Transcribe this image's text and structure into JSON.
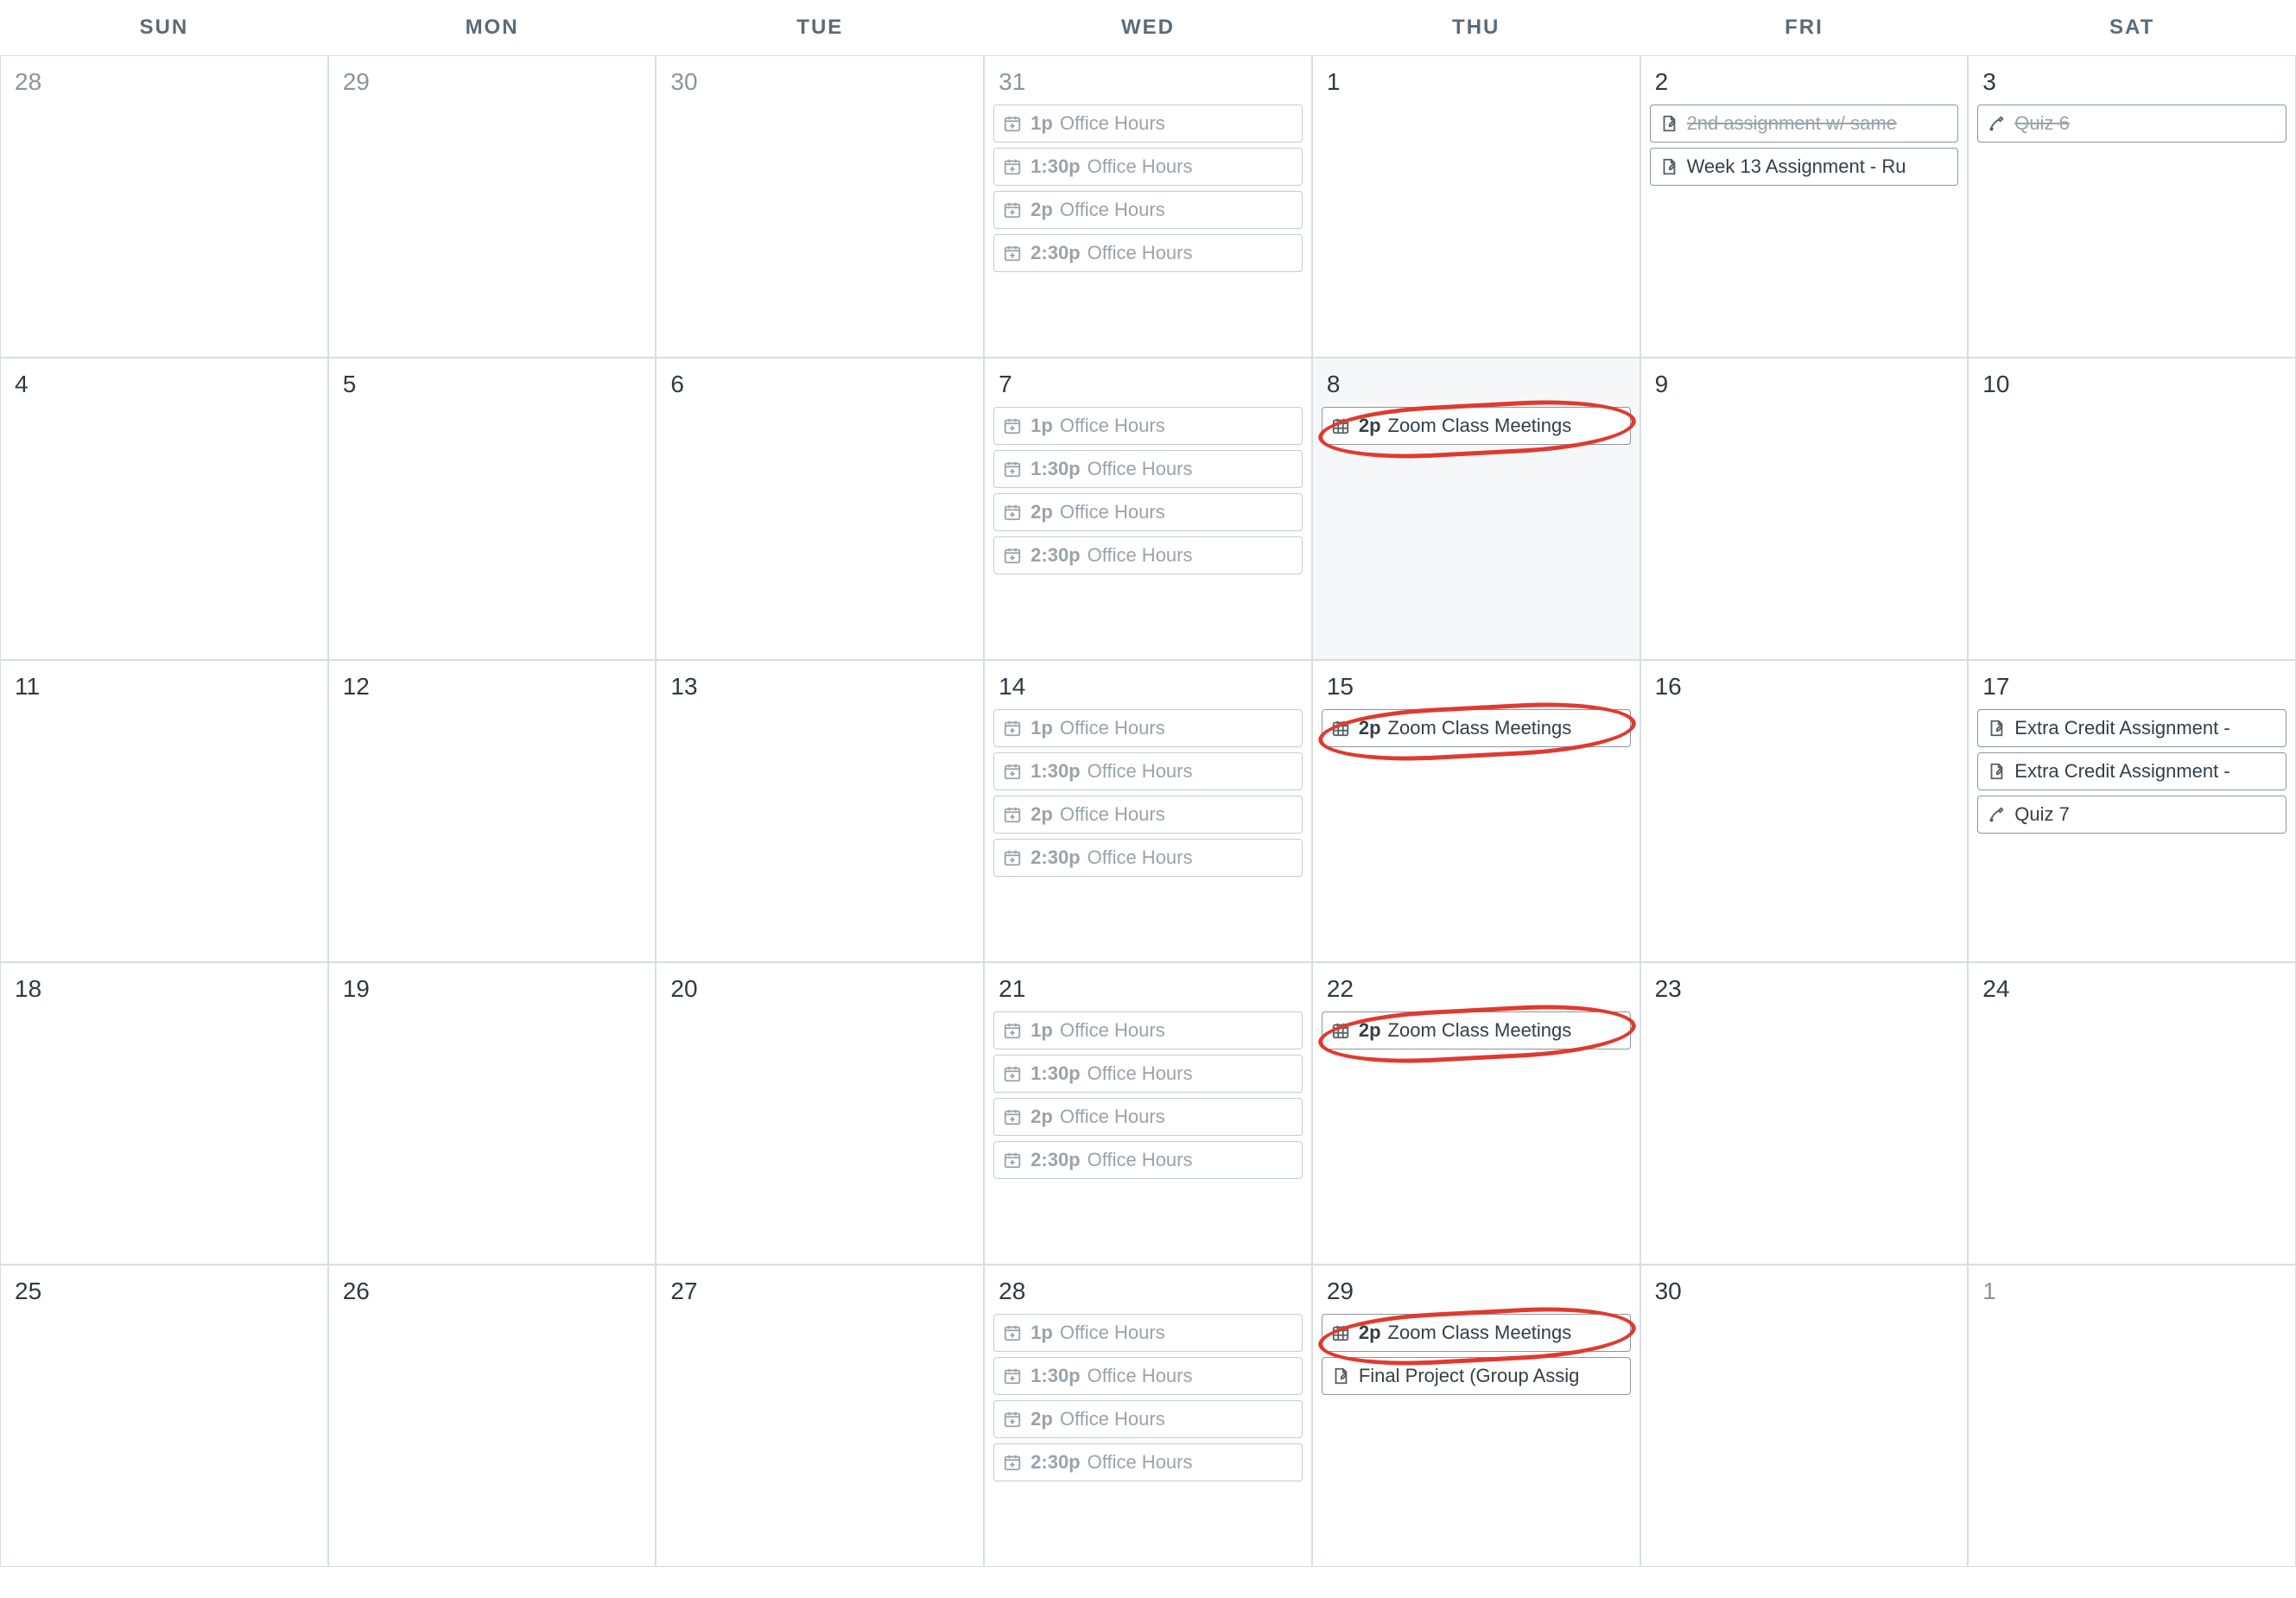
{
  "dow": [
    "SUN",
    "MON",
    "TUE",
    "WED",
    "THU",
    "FRI",
    "SAT"
  ],
  "weeks": [
    [
      {
        "n": "28",
        "other": true,
        "events": []
      },
      {
        "n": "29",
        "other": true,
        "events": []
      },
      {
        "n": "30",
        "other": true,
        "events": []
      },
      {
        "n": "31",
        "other": true,
        "events": [
          {
            "icon": "cal-plus",
            "time": "1p",
            "title": "Office Hours",
            "muted": true
          },
          {
            "icon": "cal-plus",
            "time": "1:30p",
            "title": "Office Hours",
            "muted": true
          },
          {
            "icon": "cal-plus",
            "time": "2p",
            "title": "Office Hours",
            "muted": true
          },
          {
            "icon": "cal-plus",
            "time": "2:30p",
            "title": "Office Hours",
            "muted": true
          }
        ]
      },
      {
        "n": "1",
        "events": []
      },
      {
        "n": "2",
        "events": [
          {
            "icon": "assignment",
            "title": "2nd assignment w/ same",
            "strike": true
          },
          {
            "icon": "assignment",
            "title": "Week 13 Assignment - Ru"
          }
        ]
      },
      {
        "n": "3",
        "events": [
          {
            "icon": "quiz",
            "title": "Quiz 6",
            "strike": true
          }
        ]
      }
    ],
    [
      {
        "n": "4",
        "events": []
      },
      {
        "n": "5",
        "events": []
      },
      {
        "n": "6",
        "events": []
      },
      {
        "n": "7",
        "events": [
          {
            "icon": "cal-plus",
            "time": "1p",
            "title": "Office Hours",
            "muted": true
          },
          {
            "icon": "cal-plus",
            "time": "1:30p",
            "title": "Office Hours",
            "muted": true
          },
          {
            "icon": "cal-plus",
            "time": "2p",
            "title": "Office Hours",
            "muted": true
          },
          {
            "icon": "cal-plus",
            "time": "2:30p",
            "title": "Office Hours",
            "muted": true
          }
        ]
      },
      {
        "n": "8",
        "today": true,
        "circled": true,
        "events": [
          {
            "icon": "cal-grid",
            "time": "2p",
            "title": "Zoom Class Meetings",
            "bold": true
          }
        ]
      },
      {
        "n": "9",
        "events": []
      },
      {
        "n": "10",
        "events": []
      }
    ],
    [
      {
        "n": "11",
        "events": []
      },
      {
        "n": "12",
        "events": []
      },
      {
        "n": "13",
        "events": []
      },
      {
        "n": "14",
        "events": [
          {
            "icon": "cal-plus",
            "time": "1p",
            "title": "Office Hours",
            "muted": true
          },
          {
            "icon": "cal-plus",
            "time": "1:30p",
            "title": "Office Hours",
            "muted": true
          },
          {
            "icon": "cal-plus",
            "time": "2p",
            "title": "Office Hours",
            "muted": true
          },
          {
            "icon": "cal-plus",
            "time": "2:30p",
            "title": "Office Hours",
            "muted": true
          }
        ]
      },
      {
        "n": "15",
        "circled": true,
        "events": [
          {
            "icon": "cal-grid",
            "time": "2p",
            "title": "Zoom Class Meetings",
            "bold": true
          }
        ]
      },
      {
        "n": "16",
        "events": []
      },
      {
        "n": "17",
        "events": [
          {
            "icon": "assignment",
            "title": "Extra Credit Assignment -"
          },
          {
            "icon": "assignment",
            "title": "Extra Credit Assignment -"
          },
          {
            "icon": "quiz",
            "title": "Quiz 7"
          }
        ]
      }
    ],
    [
      {
        "n": "18",
        "events": []
      },
      {
        "n": "19",
        "events": []
      },
      {
        "n": "20",
        "events": []
      },
      {
        "n": "21",
        "events": [
          {
            "icon": "cal-plus",
            "time": "1p",
            "title": "Office Hours",
            "muted": true
          },
          {
            "icon": "cal-plus",
            "time": "1:30p",
            "title": "Office Hours",
            "muted": true
          },
          {
            "icon": "cal-plus",
            "time": "2p",
            "title": "Office Hours",
            "muted": true
          },
          {
            "icon": "cal-plus",
            "time": "2:30p",
            "title": "Office Hours",
            "muted": true
          }
        ]
      },
      {
        "n": "22",
        "circled": true,
        "events": [
          {
            "icon": "cal-grid",
            "time": "2p",
            "title": "Zoom Class Meetings",
            "bold": true
          }
        ]
      },
      {
        "n": "23",
        "events": []
      },
      {
        "n": "24",
        "events": []
      }
    ],
    [
      {
        "n": "25",
        "events": []
      },
      {
        "n": "26",
        "events": []
      },
      {
        "n": "27",
        "events": []
      },
      {
        "n": "28",
        "events": [
          {
            "icon": "cal-plus",
            "time": "1p",
            "title": "Office Hours",
            "muted": true
          },
          {
            "icon": "cal-plus",
            "time": "1:30p",
            "title": "Office Hours",
            "muted": true
          },
          {
            "icon": "cal-plus",
            "time": "2p",
            "title": "Office Hours",
            "muted": true
          },
          {
            "icon": "cal-plus",
            "time": "2:30p",
            "title": "Office Hours",
            "muted": true
          }
        ]
      },
      {
        "n": "29",
        "circled": true,
        "events": [
          {
            "icon": "cal-grid",
            "time": "2p",
            "title": "Zoom Class Meetings",
            "bold": true
          },
          {
            "icon": "assignment",
            "title": "Final Project (Group Assig"
          }
        ]
      },
      {
        "n": "30",
        "events": []
      },
      {
        "n": "1",
        "other": true,
        "events": []
      }
    ]
  ]
}
